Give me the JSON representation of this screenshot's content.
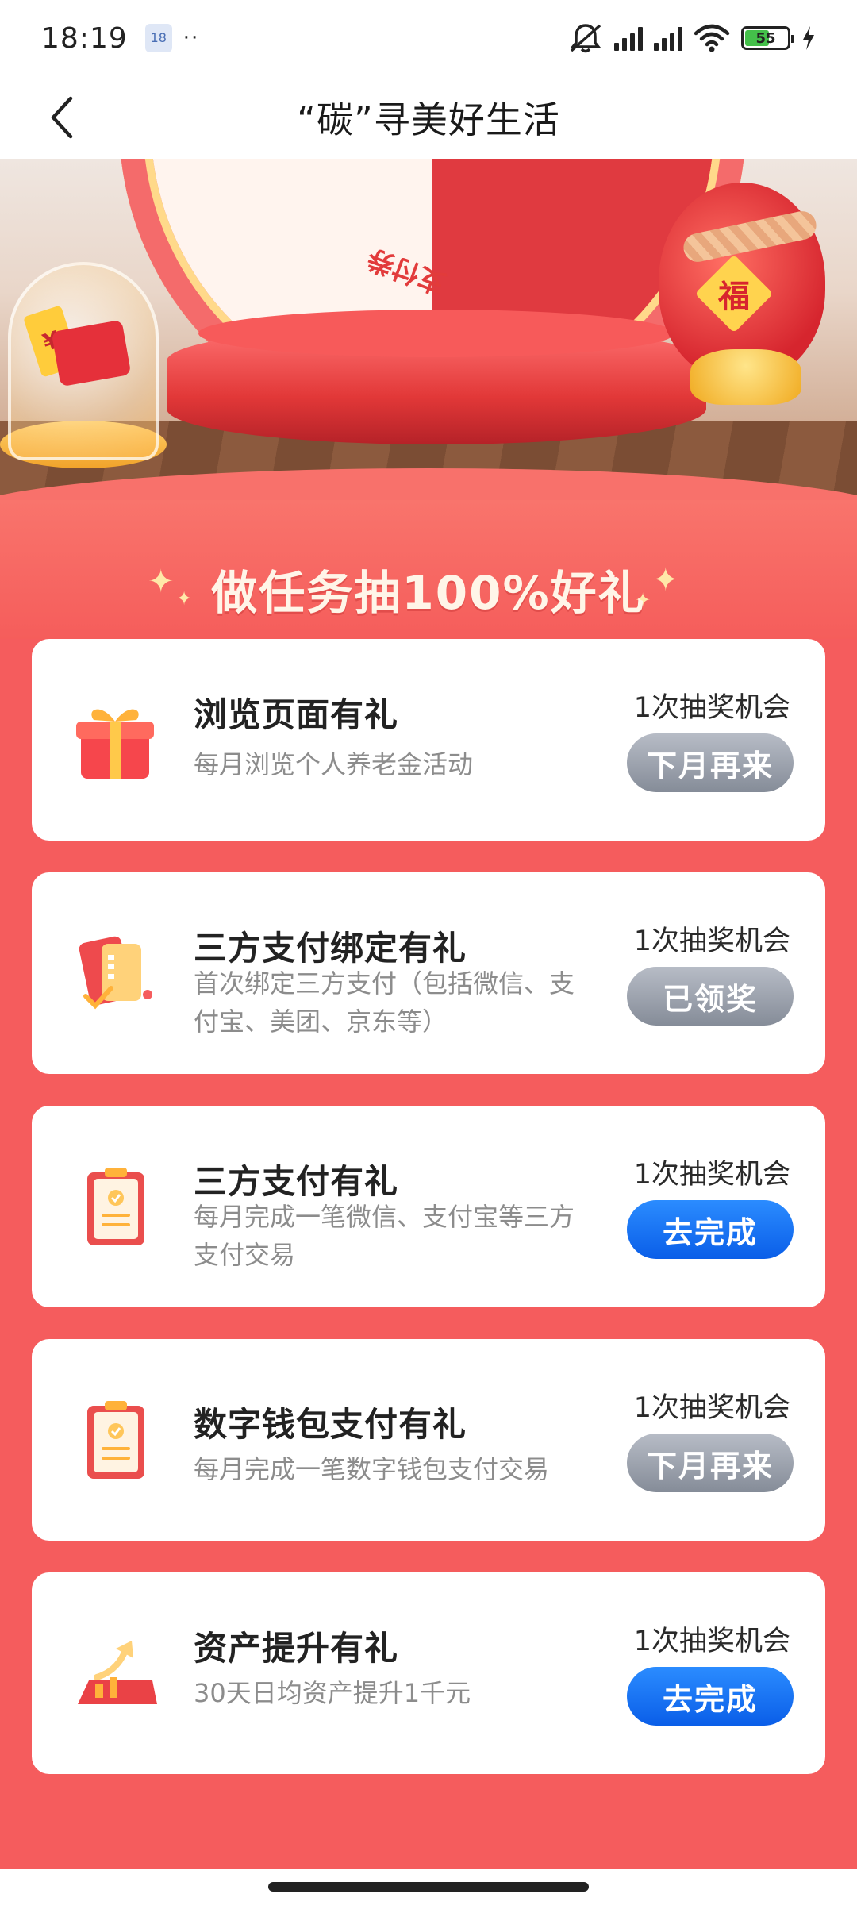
{
  "status_bar": {
    "time": "18:19",
    "notif_badge": "18",
    "dots": "··",
    "battery": "55"
  },
  "nav": {
    "title": "“碳”寻美好生活"
  },
  "banner": {
    "wheel_label": "支付券",
    "fu_char": "福",
    "jar_symbol": "¥",
    "headline": "做任务抽100%好礼"
  },
  "tasks": [
    {
      "title": "浏览页面有礼",
      "desc": "每月浏览个人养老金活动",
      "chance": "1次抽奖机会",
      "button": "下月再来",
      "button_state": "disabled"
    },
    {
      "title": "三方支付绑定有礼",
      "desc": "首次绑定三方支付（包括微信、支付宝、美团、京东等）",
      "chance": "1次抽奖机会",
      "button": "已领奖",
      "button_state": "disabled"
    },
    {
      "title": "三方支付有礼",
      "desc": "每月完成一笔微信、支付宝等三方支付交易",
      "chance": "1次抽奖机会",
      "button": "去完成",
      "button_state": "active"
    },
    {
      "title": "数字钱包支付有礼",
      "desc": "每月完成一笔数字钱包支付交易",
      "chance": "1次抽奖机会",
      "button": "下月再来",
      "button_state": "disabled"
    },
    {
      "title": "资产提升有礼",
      "desc": "30天日均资产提升1千元",
      "chance": "1次抽奖机会",
      "button": "去完成",
      "button_state": "active"
    }
  ],
  "icons": {
    "task_0": "gift-box-icon",
    "task_1": "payment-card-icon",
    "task_2": "clipboard-check-icon",
    "task_3": "clipboard-check-icon",
    "task_4": "asset-growth-icon"
  },
  "colors": {
    "page_red": "#f55c5d",
    "btn_blue": "#0a5ee8",
    "btn_gray": "#858c98"
  }
}
